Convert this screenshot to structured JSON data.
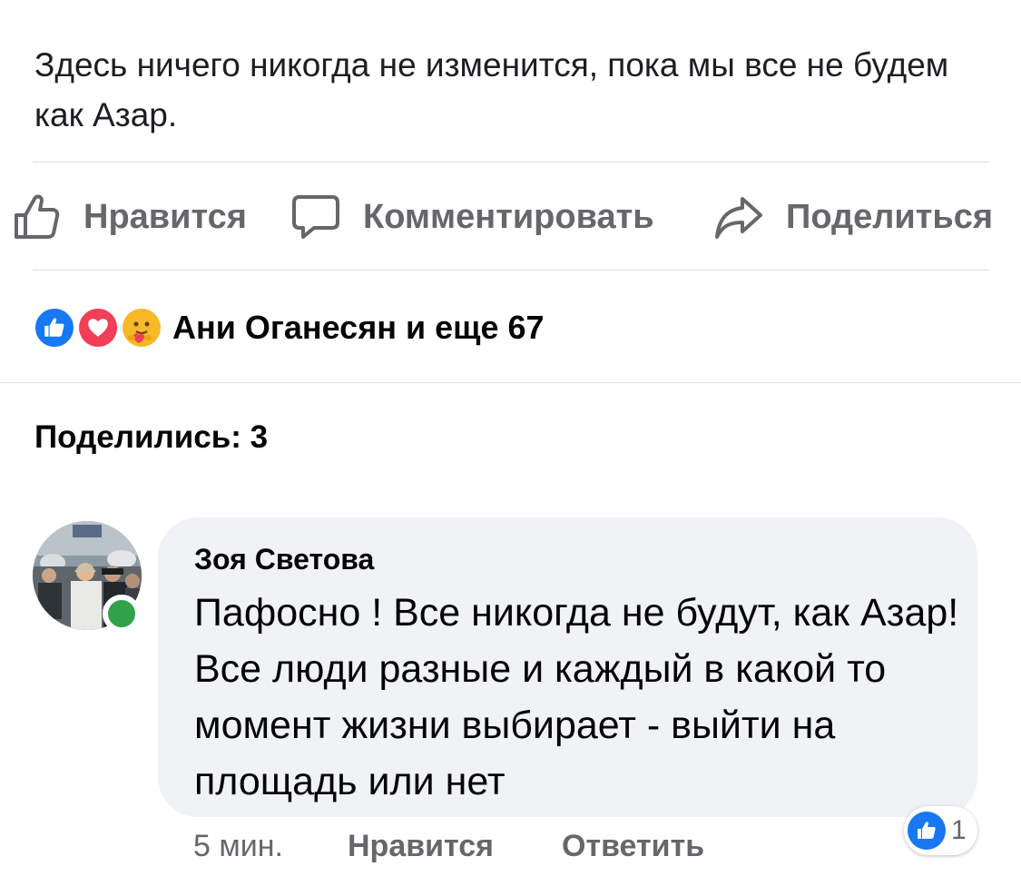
{
  "post": {
    "text": "Здесь ничего никогда не изменится, пока мы все не будем как Азар."
  },
  "actions": {
    "like": "Нравится",
    "comment": "Комментировать",
    "share": "Поделиться"
  },
  "reactions": {
    "icons": [
      "like-icon",
      "love-icon",
      "care-icon"
    ],
    "summary": "Ани Оганесян и еще 67"
  },
  "shares": {
    "label": "Поделились: 3"
  },
  "comment": {
    "author": "Зоя Светова",
    "text": "Пафосно ! Все никогда не будут, как Азар! Все люди разные и каждый в какой то момент жизни выбирает - выйти на площадь или нет",
    "online": true,
    "time": "5 мин.",
    "like_label": "Нравится",
    "reply_label": "Ответить",
    "reaction_icon": "like-icon",
    "reaction_count": "1"
  },
  "colors": {
    "like_blue": "#1877f2",
    "love_red": "#f33e58",
    "care_yellow": "#f7b928",
    "online_green": "#31a24c",
    "secondary_text": "#65676b",
    "bubble_bg": "#f0f2f5"
  }
}
